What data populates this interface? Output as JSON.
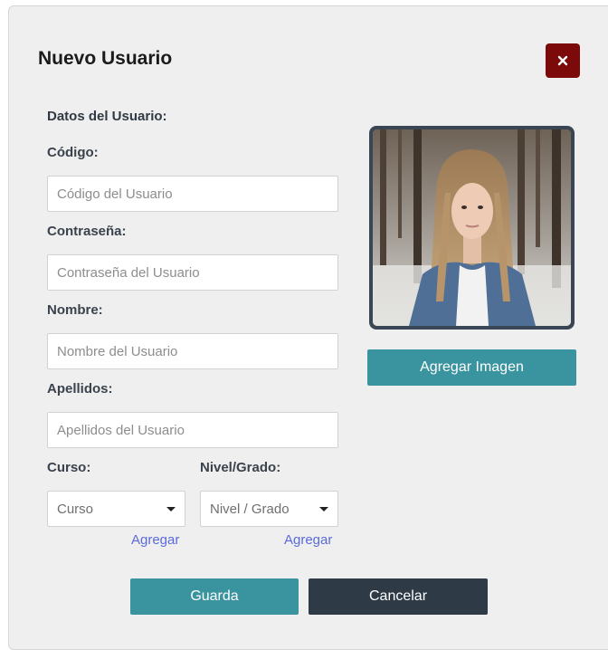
{
  "modal": {
    "title": "Nuevo Usuario",
    "close_icon": "close-icon"
  },
  "form": {
    "section_title": "Datos del Usuario:",
    "codigo": {
      "label": "Código:",
      "placeholder": "Código del Usuario",
      "value": ""
    },
    "contrasena": {
      "label": "Contraseña:",
      "placeholder": "Contraseña del Usuario",
      "value": ""
    },
    "nombre": {
      "label": "Nombre:",
      "placeholder": "Nombre del Usuario",
      "value": ""
    },
    "apellidos": {
      "label": "Apellidos:",
      "placeholder": "Apellidos del Usuario",
      "value": ""
    },
    "curso": {
      "label": "Curso:",
      "selected": "Curso",
      "add_link": "Agregar"
    },
    "nivel": {
      "label": "Nivel/Grado:",
      "selected": "Nivel / Grado",
      "add_link": "Agregar"
    }
  },
  "image": {
    "add_button": "Agregar Imagen"
  },
  "actions": {
    "save_label": "Guarda",
    "cancel_label": "Cancelar"
  },
  "colors": {
    "close_button": "#7c0a0a",
    "teal_button": "#3a94a0",
    "dark_button": "#2e3a46",
    "link": "#5a6bdc",
    "photo_frame": "#3a4654"
  }
}
